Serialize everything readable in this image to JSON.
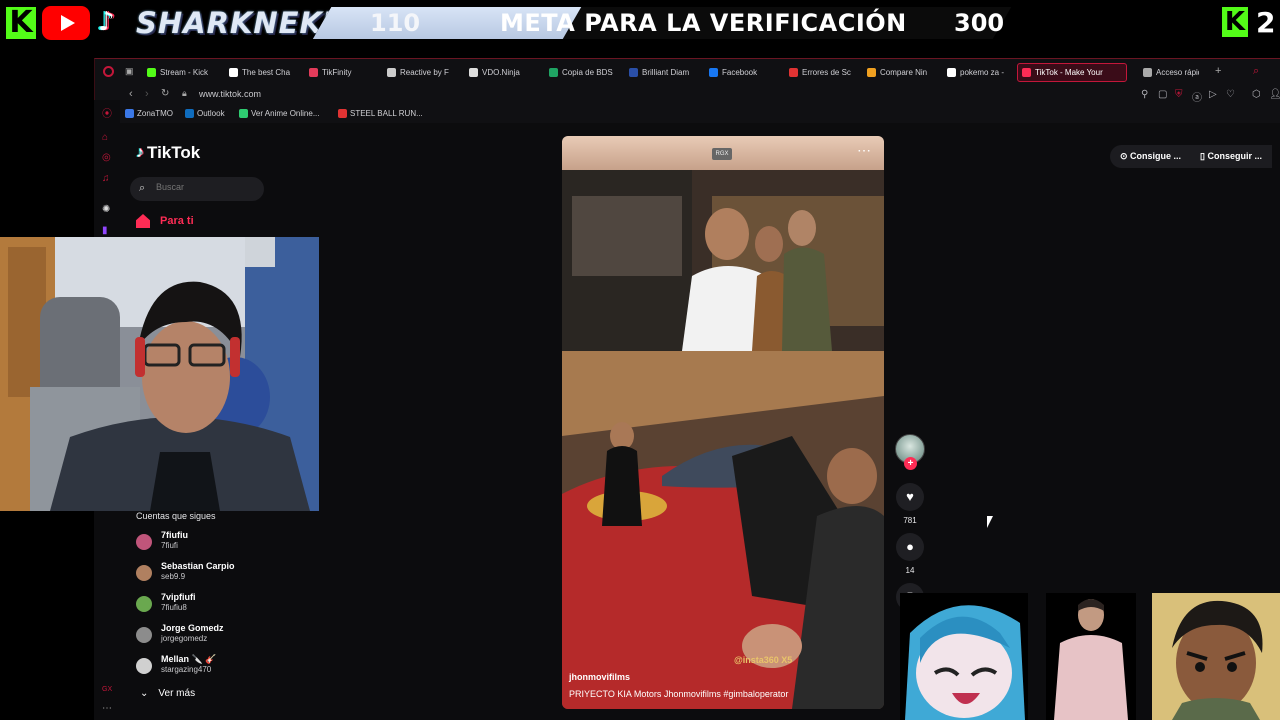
{
  "overlay": {
    "channel_name": "SHARKNEKU",
    "goal_current": "110",
    "goal_label": "META PARA LA VERIFICACIÓN",
    "goal_target": "300",
    "goal_progress": 0.367,
    "kick_count": "2",
    "icons": [
      "kick-icon",
      "youtube-icon",
      "tiktok-icon"
    ]
  },
  "browser": {
    "tabs": [
      {
        "label": "Stream - Kick",
        "favicon_color": "#53fc18"
      },
      {
        "label": "The best Cha",
        "favicon_color": "#ffffff"
      },
      {
        "label": "TikFinity",
        "favicon_color": "#e23b5a"
      },
      {
        "label": "Reactive by F",
        "favicon_color": "#cccccc"
      },
      {
        "label": "VDO.Ninja",
        "favicon_color": "#dddddd"
      },
      {
        "label": "Copia de BDS",
        "favicon_color": "#1fa463"
      },
      {
        "label": "Brilliant Diam",
        "favicon_color": "#2a4fa8"
      },
      {
        "label": "Facebook",
        "favicon_color": "#1877f2"
      },
      {
        "label": "Errores de Sc",
        "favicon_color": "#e03333"
      },
      {
        "label": "Compare Nin",
        "favicon_color": "#f0a020"
      },
      {
        "label": "pokemo za -",
        "favicon_color": "#ffffff"
      },
      {
        "label": "TikTok - Make Your",
        "favicon_color": "#fe2c55",
        "active": true
      },
      {
        "label": "Acceso rápid",
        "favicon_color": "#aaaaaa"
      }
    ],
    "url": "www.tiktok.com",
    "bookmarks": [
      {
        "label": "ZonaTMO",
        "favicon_color": "#3b78e7"
      },
      {
        "label": "Outlook",
        "favicon_color": "#0f6cbd"
      },
      {
        "label": "Ver Anime Online...",
        "favicon_color": "#2ecc71"
      },
      {
        "label": "STEEL BALL RUN...",
        "favicon_color": "#e03333"
      }
    ]
  },
  "tiktok": {
    "brand": "TikTok",
    "search_placeholder": "Buscar",
    "nav_for_you": "Para ti",
    "following_title": "Cuentas que sigues",
    "following": [
      {
        "name": "7fiufiu",
        "handle": "7fiufi",
        "avatar_color": "#c0557a"
      },
      {
        "name": "Sebastian Carpio",
        "handle": "seb9.9",
        "avatar_color": "#b08060"
      },
      {
        "name": "7vipfiufi",
        "handle": "7fiufiu8",
        "avatar_color": "#6aa84f"
      },
      {
        "name": "Jorge Gomedz",
        "handle": "jorgegomedz",
        "avatar_color": "#8c8c8c"
      },
      {
        "name": "Mellan 🔪 🎸",
        "handle": "stargazing470",
        "avatar_color": "#d0d0d0"
      }
    ],
    "see_more": "Ver más",
    "video": {
      "author": "jhonmovifilms",
      "caption": "PRIYECTO KIA Motors  Jhonmovifilms #gimbaloperator",
      "watermark": "@insta360 X5",
      "badge": "RGX",
      "likes": "781",
      "comments": "14"
    },
    "pills": [
      "Consigue ...",
      "Conseguir ..."
    ]
  }
}
